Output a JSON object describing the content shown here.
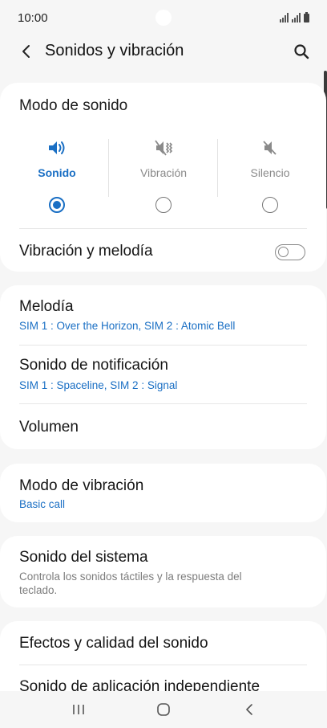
{
  "status_bar": {
    "time": "10:00",
    "icons": [
      "signal-sim1-icon",
      "signal-sim2-icon",
      "battery-icon"
    ]
  },
  "header": {
    "title": "Sonidos y vibración",
    "back_icon": "back-arrow-icon",
    "search_icon": "search-icon"
  },
  "sound_mode": {
    "title": "Modo de sonido",
    "modes": [
      {
        "label": "Sonido",
        "icon": "speaker-icon",
        "selected": true
      },
      {
        "label": "Vibración",
        "icon": "vibrate-icon",
        "selected": false
      },
      {
        "label": "Silencio",
        "icon": "mute-icon",
        "selected": false
      }
    ],
    "accent_color": "#1a6fc4"
  },
  "vibration_melody": {
    "label": "Vibración y melodía",
    "enabled": false
  },
  "sounds": {
    "ringtone_title": "Melodía",
    "ringtone_value": "SIM 1 : Over the Horizon, SIM 2 : Atomic Bell",
    "notification_title": "Sonido de notificación",
    "notification_value": "SIM 1 : Spaceline, SIM 2 : Signal",
    "volume_title": "Volumen"
  },
  "vibration_pattern": {
    "title": "Modo de vibración",
    "value": "Basic call"
  },
  "system_sound": {
    "title": "Sonido del sistema",
    "description": "Controla los sonidos táctiles y la respuesta del teclado."
  },
  "advanced": {
    "effects_title": "Efectos y calidad del sonido",
    "separate_app_title": "Sonido de aplicación independiente"
  },
  "nav_bar": {
    "buttons": [
      "recent-apps-icon",
      "home-icon",
      "back-icon"
    ]
  }
}
